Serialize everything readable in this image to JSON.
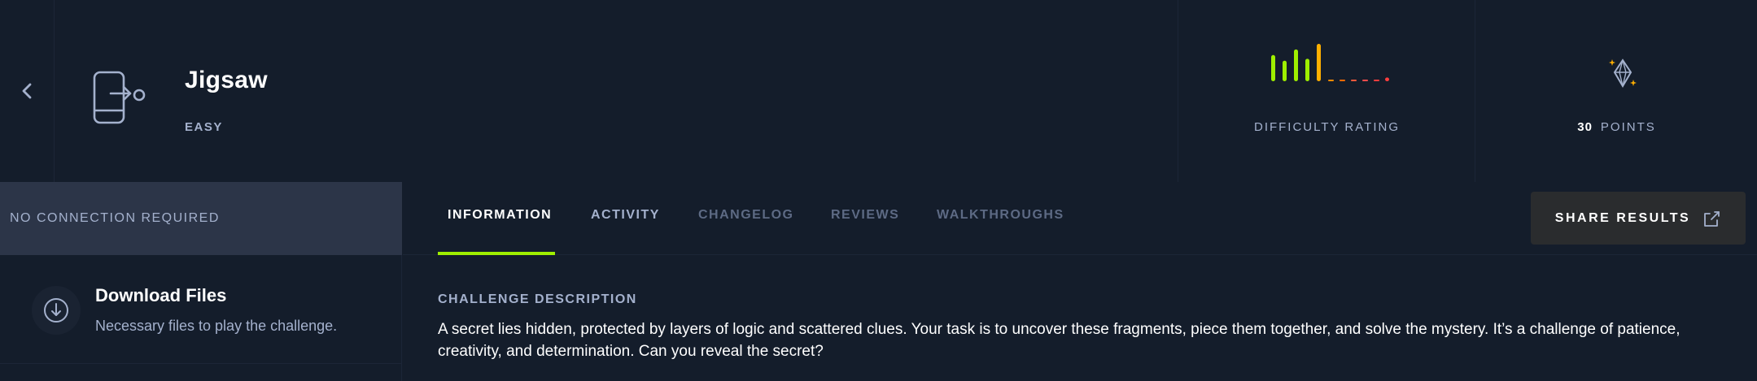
{
  "header": {
    "title": "Jigsaw",
    "difficulty": "EASY",
    "rating_label": "DIFFICULTY RATING",
    "points_value": "30",
    "points_label": "POINTS"
  },
  "difficulty_chart": {
    "bars": [
      {
        "level": 0.7,
        "color": "#9fef00"
      },
      {
        "level": 0.55,
        "color": "#9fef00"
      },
      {
        "level": 0.85,
        "color": "#9fef00"
      },
      {
        "level": 0.6,
        "color": "#9fef00"
      },
      {
        "level": 1.0,
        "color": "#ffaf00"
      },
      {
        "level": 0.02,
        "color": "#ff8d00"
      },
      {
        "level": 0.02,
        "color": "#ff6a00"
      },
      {
        "level": 0.02,
        "color": "#ff5a3c"
      },
      {
        "level": 0.02,
        "color": "#ff4d4d"
      },
      {
        "level": 0.02,
        "color": "#ff3e3e"
      },
      {
        "level": 0.1,
        "color": "#ff3e3e"
      }
    ]
  },
  "sidebar": {
    "connection_status": "NO CONNECTION REQUIRED",
    "download_title": "Download Files",
    "download_subtitle": "Necessary files to play the challenge."
  },
  "tabs": [
    {
      "label": "INFORMATION"
    },
    {
      "label": "ACTIVITY"
    },
    {
      "label": "CHANGELOG"
    },
    {
      "label": "REVIEWS"
    },
    {
      "label": "WALKTHROUGHS"
    }
  ],
  "share_button": {
    "label": "SHARE RESULTS"
  },
  "description": {
    "label": "CHALLENGE DESCRIPTION",
    "text": "A secret lies hidden, protected by layers of logic and scattered clues. Your task is to uncover these fragments, piece them together, and solve the mystery. It’s a challenge of patience, creativity, and determination. Can you reveal the secret?"
  },
  "colors": {
    "accent": "#9fef00",
    "background": "#141d2b",
    "muted_text": "#a4b1cd"
  }
}
